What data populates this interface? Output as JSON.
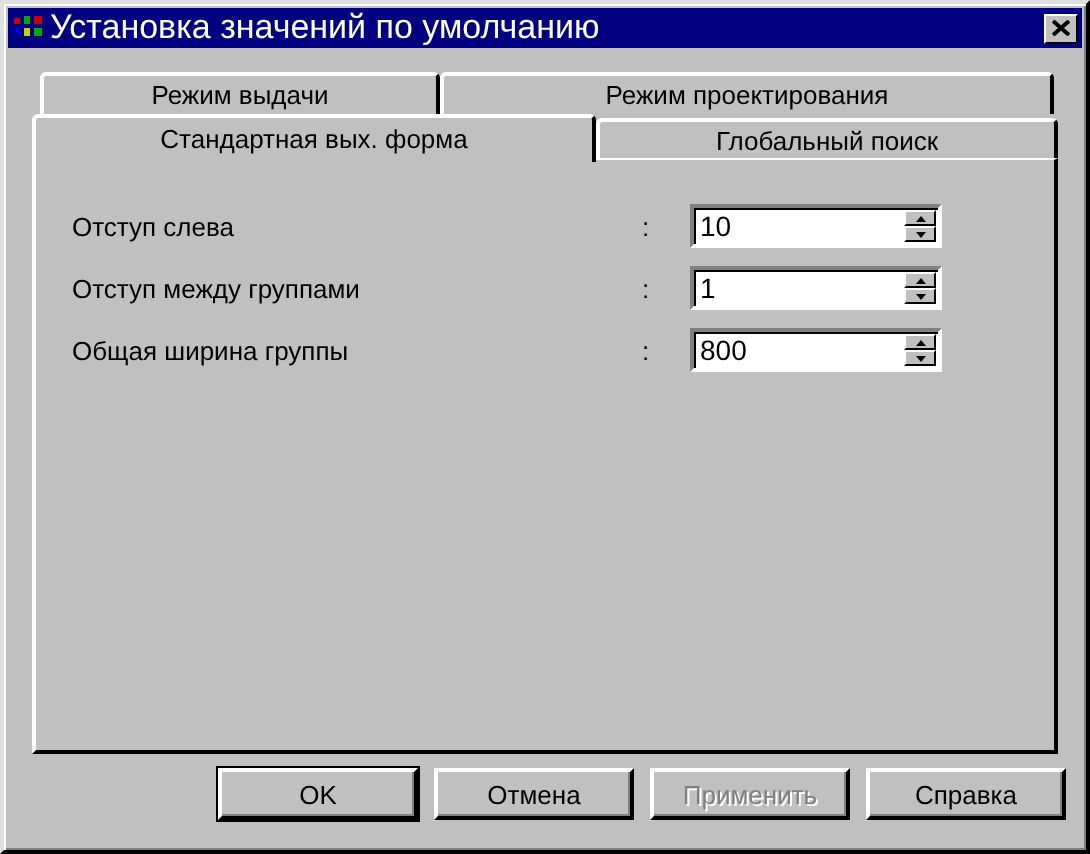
{
  "window": {
    "title": "Установка значений по умолчанию"
  },
  "tab_rows": [
    [
      {
        "label": "Режим выдачи",
        "selected": false
      },
      {
        "label": "Режим проектирования",
        "selected": false
      }
    ],
    [
      {
        "label": "Стандартная вых. форма",
        "selected": true
      },
      {
        "label": "Глобальный поиск",
        "selected": false
      }
    ]
  ],
  "fields": [
    {
      "label": "Отступ слева",
      "separator": ":",
      "value": "10"
    },
    {
      "label": "Отступ между группами",
      "separator": ":",
      "value": "1"
    },
    {
      "label": "Общая ширина группы",
      "separator": ":",
      "value": "800"
    }
  ],
  "buttons": [
    {
      "label": "OK",
      "default": true,
      "disabled": false
    },
    {
      "label": "Отмена",
      "default": false,
      "disabled": false
    },
    {
      "label": "Применить",
      "default": false,
      "disabled": true
    },
    {
      "label": "Справка",
      "default": false,
      "disabled": false
    }
  ]
}
